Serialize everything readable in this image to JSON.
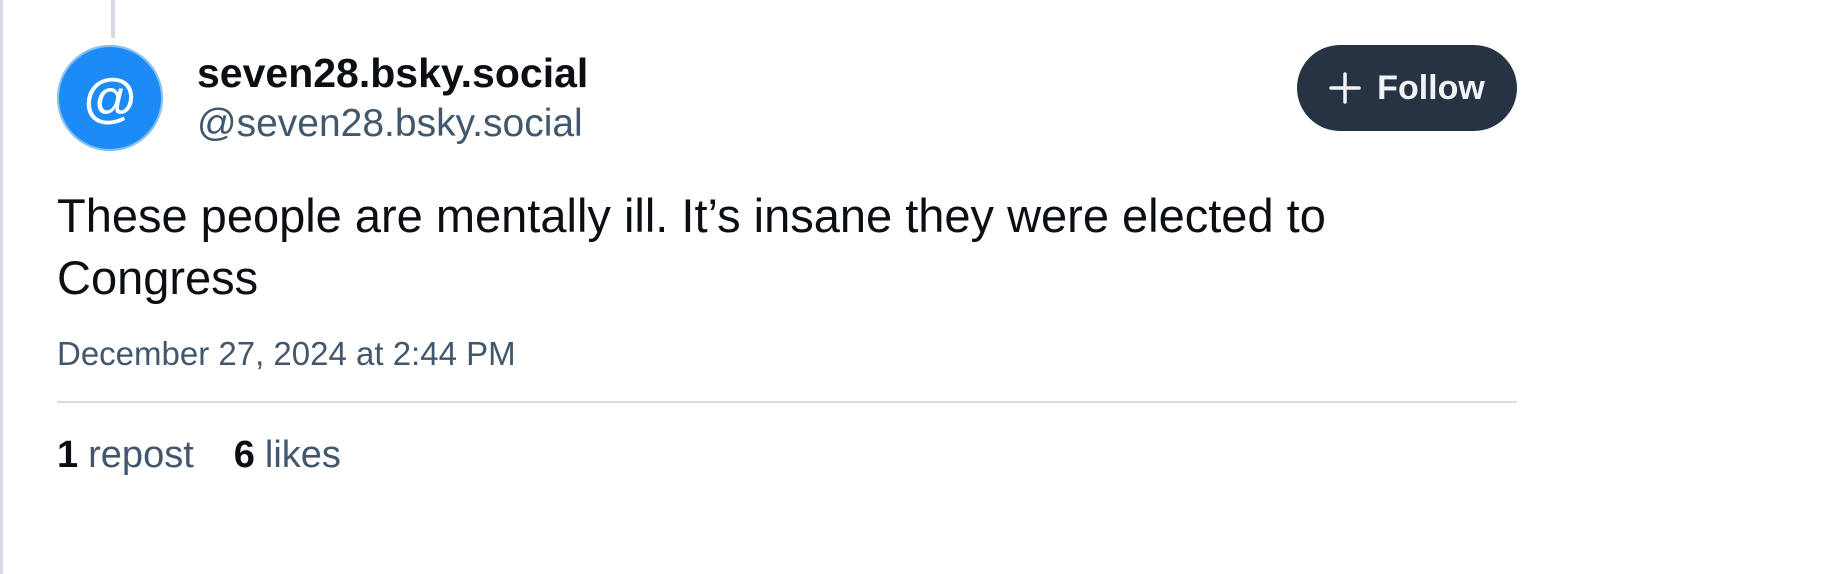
{
  "post": {
    "author": {
      "display_name": "seven28.bsky.social",
      "handle": "@seven28.bsky.social",
      "avatar_glyph": "@",
      "avatar_color": "#1d8bf5"
    },
    "follow_button": {
      "label": "Follow",
      "icon": "plus-icon",
      "background": "#263342"
    },
    "text": "These people are mentally ill. It’s insane they were elected to Congress",
    "timestamp": "December 27, 2024 at 2:44 PM",
    "stats": {
      "reposts": {
        "count": "1",
        "label": "repost"
      },
      "likes": {
        "count": "6",
        "label": "likes"
      }
    }
  }
}
